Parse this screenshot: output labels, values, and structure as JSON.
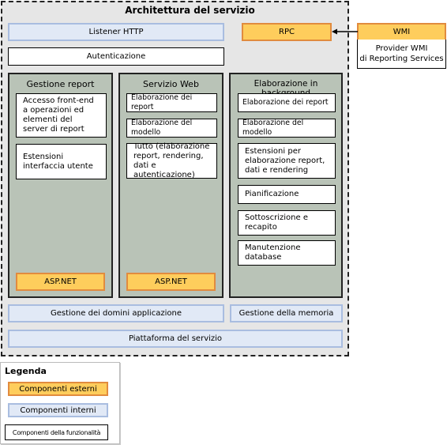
{
  "title": "Architettura del servizio",
  "top": {
    "listener": "Listener HTTP",
    "rpc": "RPC",
    "authentication": "Autenticazione"
  },
  "wmi": {
    "header": "WMI",
    "body_line1": "Provider WMI",
    "body_line2": "di Reporting Services",
    "arrow": "WMI to RPC"
  },
  "groups": [
    {
      "title": "Gestione report",
      "items": [
        "Accesso front-end a operazioni ed elementi del server di report",
        "Estensioni interfaccia utente"
      ],
      "footer": "ASP.NET"
    },
    {
      "title": "Servizio Web",
      "items": [
        "Elaborazione dei report",
        "Elaborazione del modello",
        "Tutto (elaborazione report, rendering, dati e autenticazione)"
      ],
      "footer": "ASP.NET"
    },
    {
      "title": "Elaborazione in background",
      "items": [
        "Elaborazione dei report",
        "Elaborazione del modello",
        "Estensioni per elaborazione report, dati e rendering",
        "Pianificazione",
        "Sottoscrizione e recapito",
        "Manutenzione database"
      ]
    }
  ],
  "bottom": {
    "appdomain": "Gestione dei domini applicazione",
    "memory": "Gestione della memoria",
    "platform": "Piattaforma del servizio"
  },
  "legend": {
    "title": "Legenda",
    "external": "Componenti esterni",
    "internal": "Componenti interni",
    "functional": "Componenti della funzionalità"
  },
  "colors": {
    "external_fill": "#fecd5c",
    "external_border": "#e18b3e",
    "internal_fill": "#e1e9f6",
    "internal_border": "#a9bde0",
    "group_fill": "#b9c3b7",
    "outer_fill": "#e6e6e6"
  }
}
